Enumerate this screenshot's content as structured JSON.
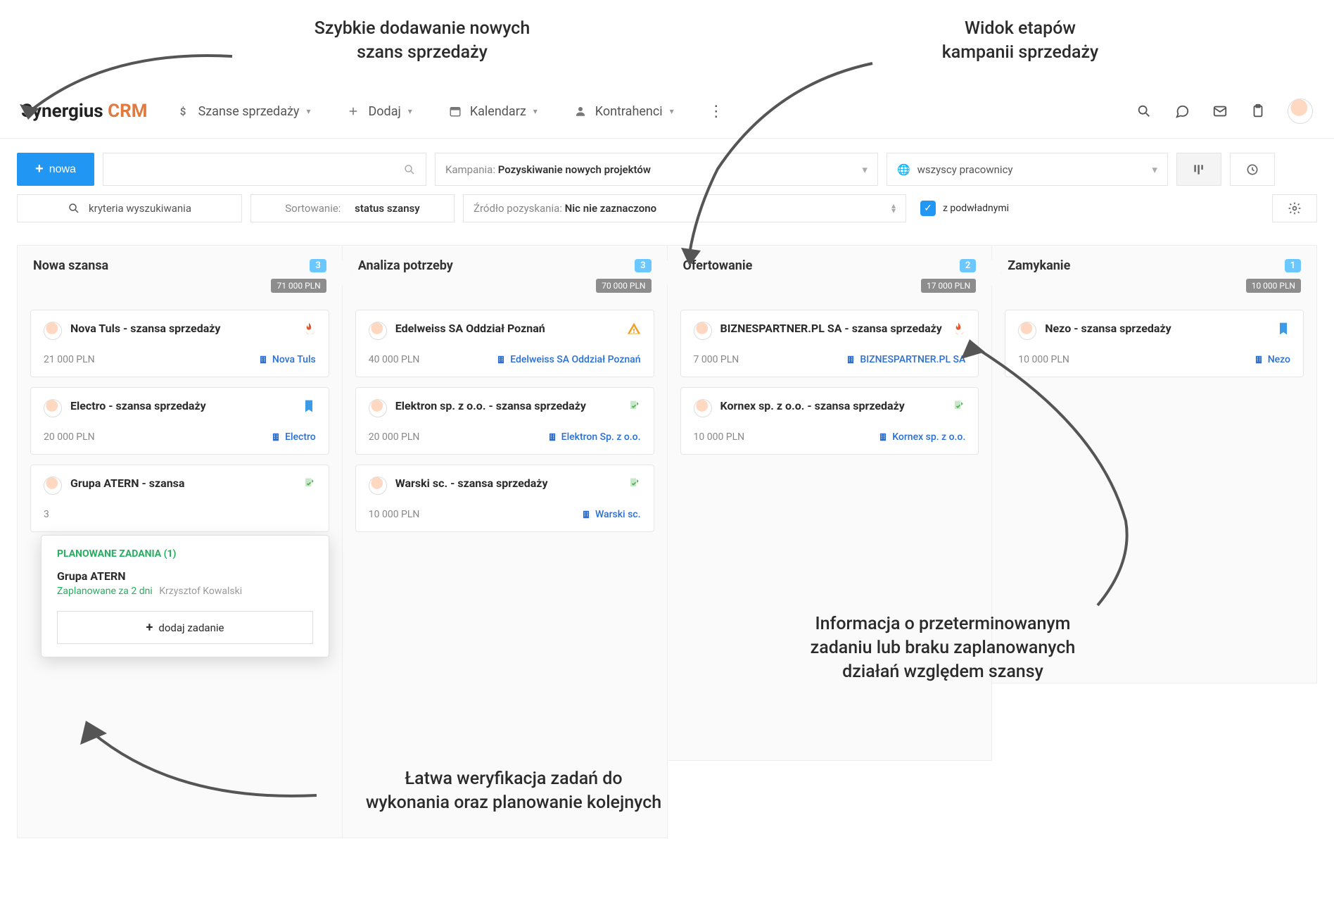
{
  "annotations": {
    "ann1": "Szybkie dodawanie nowych\nszans sprzedaży",
    "ann2": "Widok etapów\nkampanii sprzedaży",
    "ann3": "Informacja o przeterminowanym\nzadaniu lub braku zaplanowanych\ndziałań względem szansy",
    "ann4": "Łatwa weryfikacja zadań do\nwykonania oraz planowanie kolejnych"
  },
  "brand": {
    "name": "Synergius",
    "suffix": "CRM"
  },
  "nav": {
    "items": [
      {
        "label": "Szanse sprzedaży",
        "icon": "dollar-icon"
      },
      {
        "label": "Dodaj",
        "icon": "plus-icon"
      },
      {
        "label": "Kalendarz",
        "icon": "calendar-icon"
      },
      {
        "label": "Kontrahenci",
        "icon": "user-icon"
      }
    ]
  },
  "toolbar": {
    "new_btn": "nowa",
    "search_placeholder": "",
    "campaign_label": "Kampania:",
    "campaign_value": "Pozyskiwanie nowych projektów",
    "employees_value": "wszyscy pracownicy",
    "criteria_label": "kryteria wyszukiwania",
    "sort_label": "Sortowanie:",
    "sort_value": "status szansy",
    "source_label": "Źródło pozyskania:",
    "source_value": "Nic nie zaznaczono",
    "subordinates_label": "z podwładnymi"
  },
  "columns": [
    {
      "title": "Nowa szansa",
      "count": "3",
      "sum": "71 000 PLN",
      "cards": [
        {
          "title": "Nova Tuls - szansa sprzedaży",
          "value": "21 000 PLN",
          "company": "Nova Tuls",
          "flag": "fire"
        },
        {
          "title": "Electro - szansa sprzedaży",
          "value": "20 000 PLN",
          "company": "Electro",
          "flag": "book"
        },
        {
          "title": "Grupa ATERN - szansa",
          "value": "3",
          "company": "",
          "flag": "ok"
        }
      ]
    },
    {
      "title": "Analiza potrzeby",
      "count": "3",
      "sum": "70 000 PLN",
      "cards": [
        {
          "title": "Edelweiss SA Oddział Poznań",
          "value": "40 000 PLN",
          "company": "Edelweiss SA Oddział Poznań",
          "flag": "warn"
        },
        {
          "title": "Elektron sp. z o.o. - szansa sprzedaży",
          "value": "20 000 PLN",
          "company": "Elektron Sp. z o.o.",
          "flag": "ok"
        },
        {
          "title": "Warski sc. - szansa sprzedaży",
          "value": "10 000 PLN",
          "company": "Warski sc.",
          "flag": "ok"
        }
      ]
    },
    {
      "title": "Ofertowanie",
      "count": "2",
      "sum": "17 000 PLN",
      "cards": [
        {
          "title": "BIZNESPARTNER.PL SA - szansa sprzedaży",
          "value": "7 000 PLN",
          "company": "BIZNESPARTNER.PL SA",
          "flag": "fire"
        },
        {
          "title": "Kornex sp. z o.o. - szansa sprzedaży",
          "value": "10 000 PLN",
          "company": "Kornex sp. z o.o.",
          "flag": "ok"
        }
      ]
    },
    {
      "title": "Zamykanie",
      "count": "1",
      "sum": "10 000 PLN",
      "cards": [
        {
          "title": "Nezo - szansa sprzedaży",
          "value": "10 000 PLN",
          "company": "Nezo",
          "flag": "book"
        }
      ]
    }
  ],
  "popover": {
    "header": "PLANOWANE ZADANIA (1)",
    "title": "Grupa ATERN",
    "when": "Zaplanowane za 2 dni",
    "who": "Krzysztof Kowalski",
    "add_btn": "dodaj zadanie"
  }
}
